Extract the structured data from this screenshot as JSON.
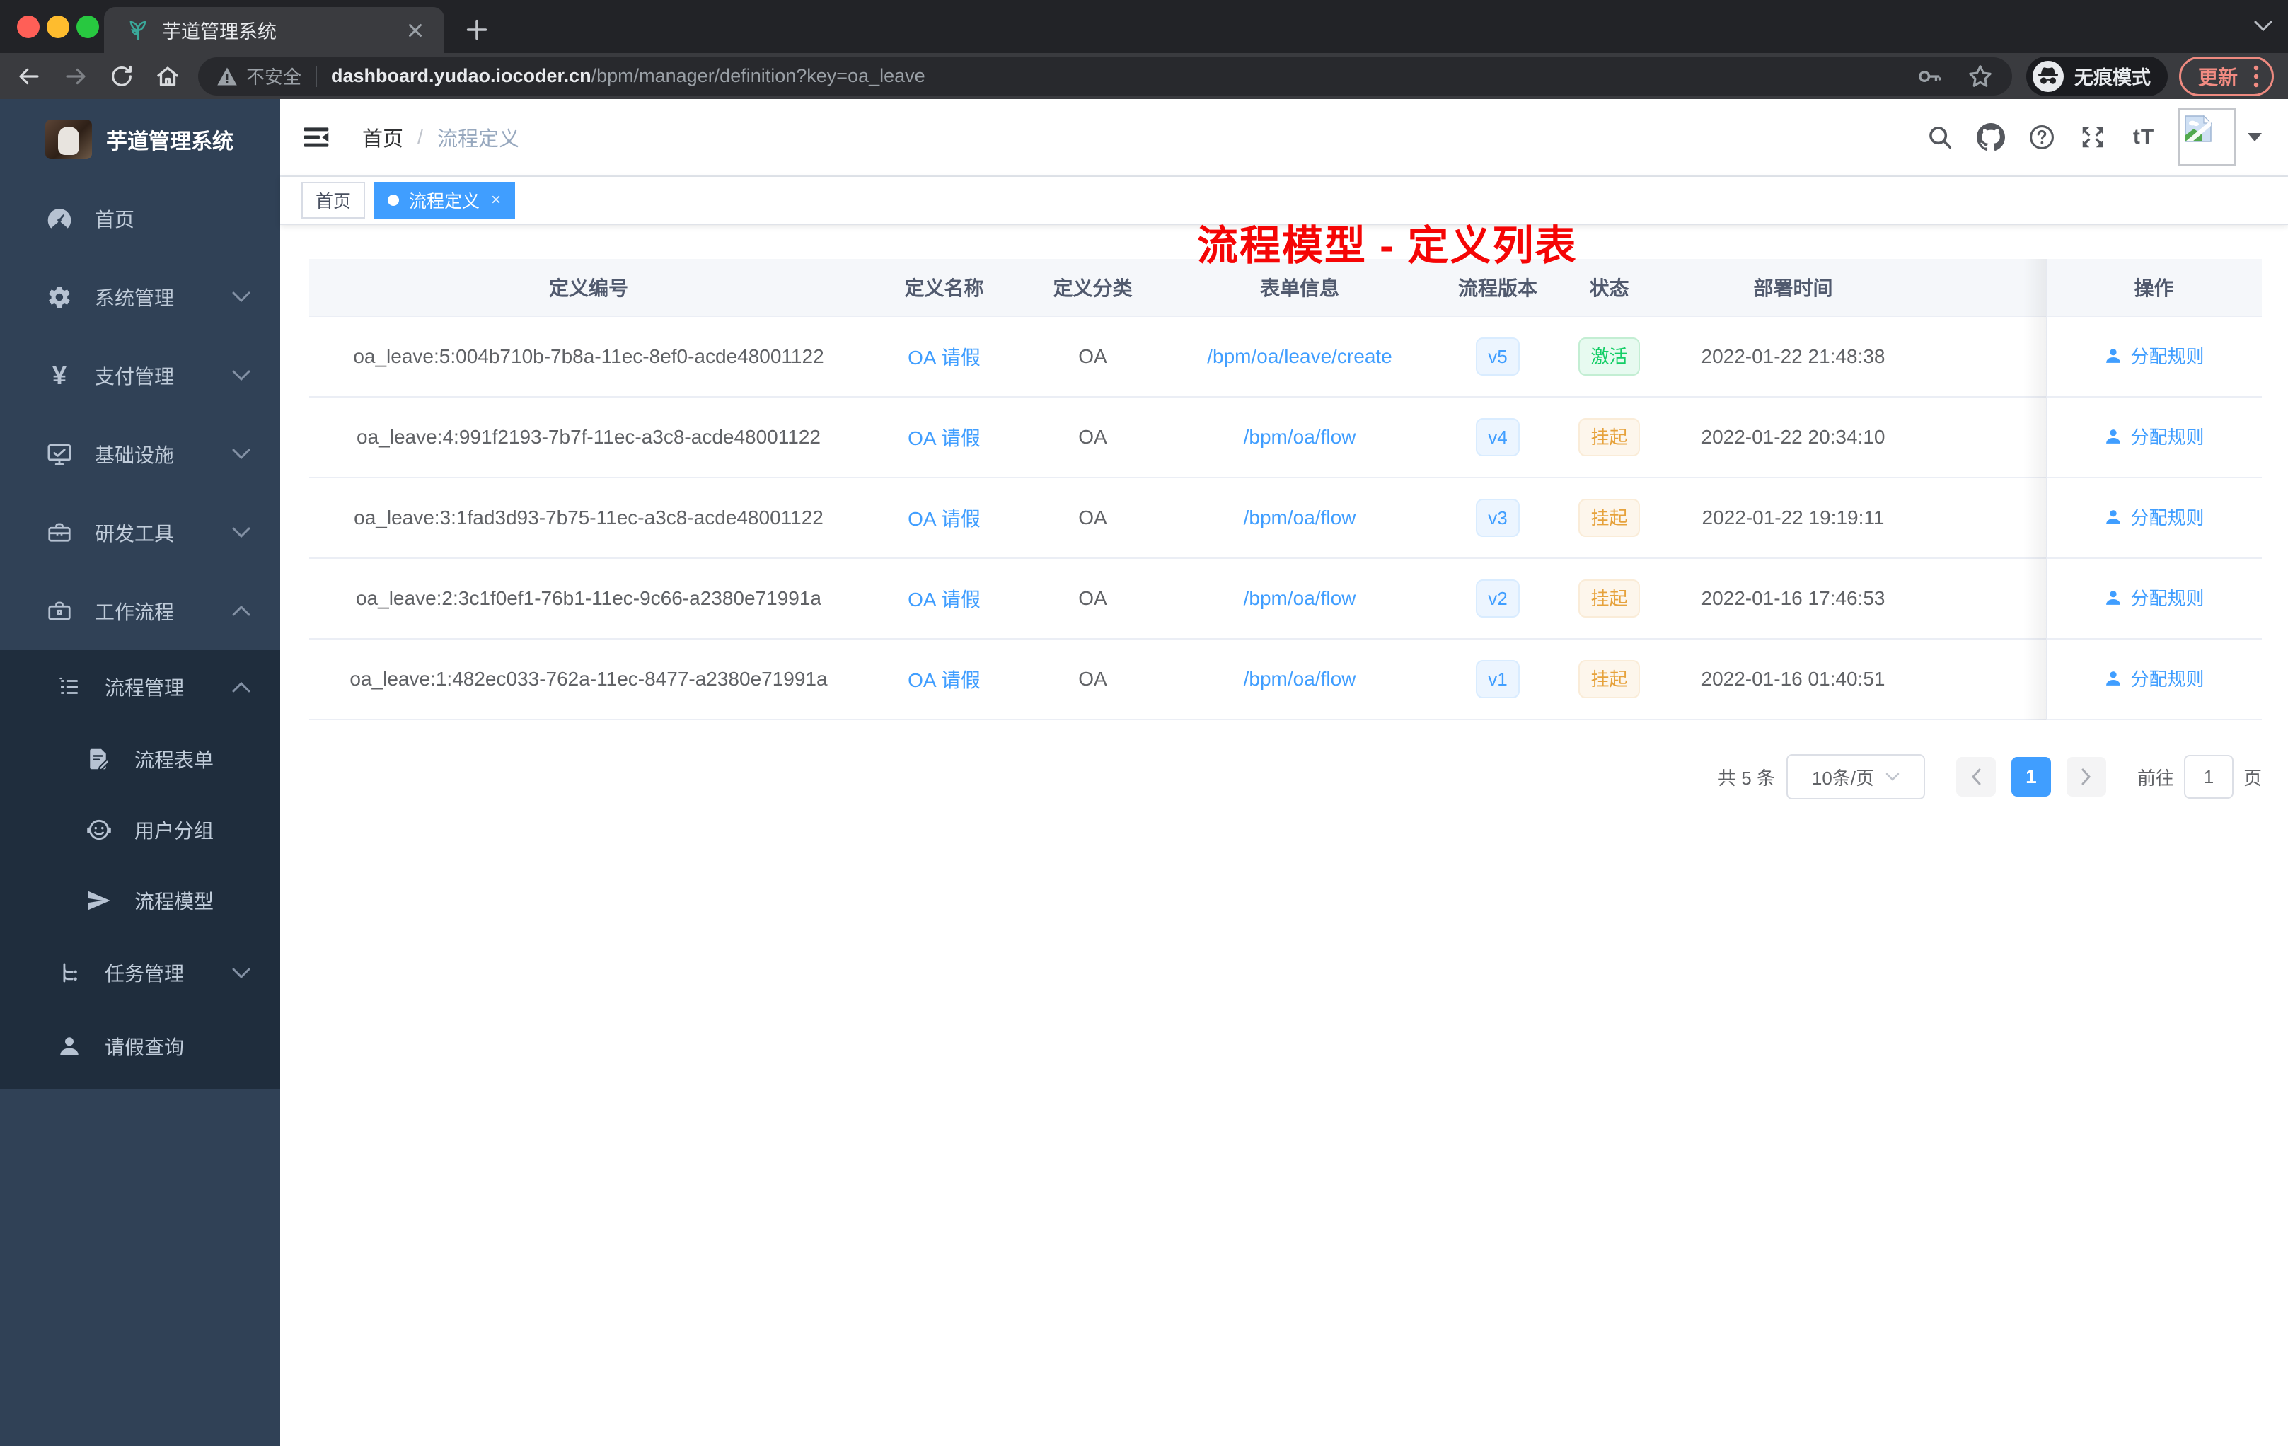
{
  "browser": {
    "tab": {
      "title": "芋道管理系统"
    },
    "address": {
      "warning_label": "不安全",
      "host": "dashboard.yudao.iocoder.cn",
      "path": "/bpm/manager/definition?key=oa_leave"
    },
    "incognito_label": "无痕模式",
    "update_label": "更新"
  },
  "sidebar": {
    "title": "芋道管理系统",
    "menu": [
      {
        "label": "首页"
      },
      {
        "label": "系统管理"
      },
      {
        "label": "支付管理"
      },
      {
        "label": "基础设施"
      },
      {
        "label": "研发工具"
      },
      {
        "label": "工作流程"
      }
    ],
    "submenu": [
      {
        "label": "流程管理"
      },
      {
        "label": "流程表单"
      },
      {
        "label": "用户分组"
      },
      {
        "label": "流程模型"
      },
      {
        "label": "任务管理"
      },
      {
        "label": "请假查询"
      }
    ]
  },
  "header": {
    "breadcrumb": {
      "home": "首页",
      "separator": "/",
      "current": "流程定义"
    },
    "annotation": "流程模型 - 定义列表",
    "font_size_icon_label": "tT"
  },
  "tags": {
    "home": "首页",
    "active": "流程定义"
  },
  "table": {
    "columns": [
      "定义编号",
      "定义名称",
      "定义分类",
      "表单信息",
      "流程版本",
      "状态",
      "部署时间",
      "操作"
    ],
    "action_label": "分配规则",
    "rows": [
      {
        "id": "oa_leave:5:004b710b-7b8a-11ec-8ef0-acde48001122",
        "name": "OA 请假",
        "category": "OA",
        "form": "/bpm/oa/leave/create",
        "version": "v5",
        "status": "激活",
        "status_type": "success",
        "deployed_at": "2022-01-22 21:48:38"
      },
      {
        "id": "oa_leave:4:991f2193-7b7f-11ec-a3c8-acde48001122",
        "name": "OA 请假",
        "category": "OA",
        "form": "/bpm/oa/flow",
        "version": "v4",
        "status": "挂起",
        "status_type": "warning",
        "deployed_at": "2022-01-22 20:34:10"
      },
      {
        "id": "oa_leave:3:1fad3d93-7b75-11ec-a3c8-acde48001122",
        "name": "OA 请假",
        "category": "OA",
        "form": "/bpm/oa/flow",
        "version": "v3",
        "status": "挂起",
        "status_type": "warning",
        "deployed_at": "2022-01-22 19:19:11"
      },
      {
        "id": "oa_leave:2:3c1f0ef1-76b1-11ec-9c66-a2380e71991a",
        "name": "OA 请假",
        "category": "OA",
        "form": "/bpm/oa/flow",
        "version": "v2",
        "status": "挂起",
        "status_type": "warning",
        "deployed_at": "2022-01-16 17:46:53"
      },
      {
        "id": "oa_leave:1:482ec033-762a-11ec-8477-a2380e71991a",
        "name": "OA 请假",
        "category": "OA",
        "form": "/bpm/oa/flow",
        "version": "v1",
        "status": "挂起",
        "status_type": "warning",
        "deployed_at": "2022-01-16 01:40:51"
      }
    ]
  },
  "pagination": {
    "total": "共 5 条",
    "page_size": "10条/页",
    "page": "1",
    "goto_label": "前往",
    "unit_label": "页"
  },
  "icons": {
    "favicon": "teal-sprout",
    "search": "magnifier",
    "github": "octocat",
    "help": "question-circle",
    "fullscreen": "expand-arrows",
    "font-size": "tT",
    "avatar": "broken-image-placeholder",
    "hamburger": "menu-collapse",
    "incognito": "hat-and-glasses",
    "action": "user-silhouette"
  },
  "colors": {
    "accent": "#409eff",
    "success": "#13ce66",
    "warning": "#e6a23c",
    "sidebar_bg": "#304156",
    "submenu_bg": "#1f2d3d",
    "annotation": "#f50505",
    "chrome_bg": "#222327",
    "toolbar_bg": "#3a3b3f",
    "update": "#f28b82"
  }
}
